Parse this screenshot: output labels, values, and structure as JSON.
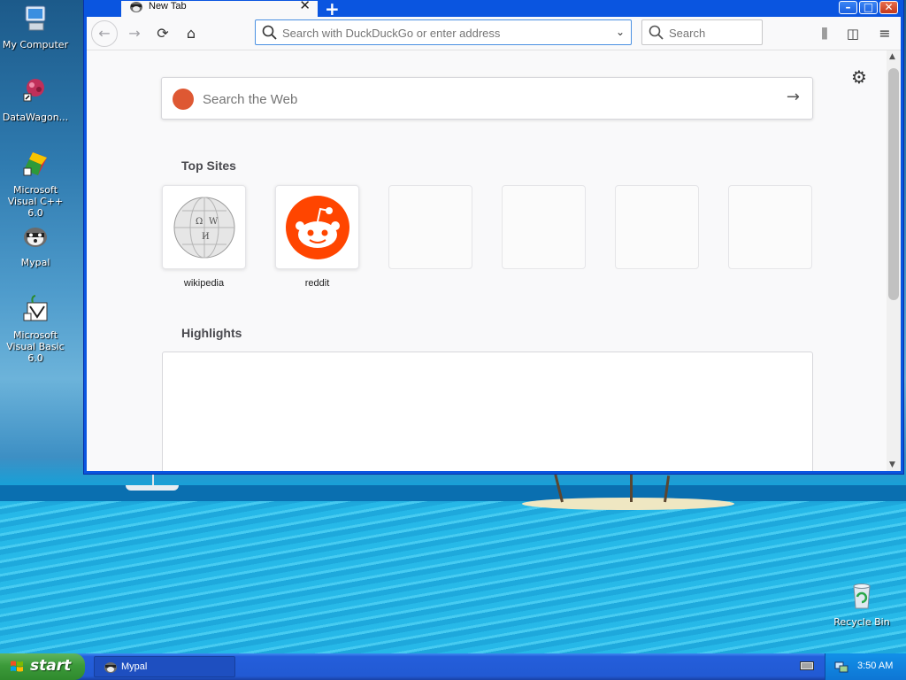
{
  "desktop": {
    "icons": [
      {
        "label": "My Computer",
        "icon": "computer-icon"
      },
      {
        "label": "DataWagon...",
        "icon": "datawagon-icon"
      },
      {
        "label": "Microsoft Visual C++ 6.0",
        "icon": "visual-cpp-icon"
      },
      {
        "label": "Mypal",
        "icon": "mypal-icon"
      },
      {
        "label": "Microsoft Visual Basic 6.0",
        "icon": "visual-basic-icon"
      },
      {
        "label": "Recycle Bin",
        "icon": "recycle-bin-icon"
      }
    ]
  },
  "browser": {
    "tab": {
      "title": "New Tab",
      "close": "✕"
    },
    "new_tab": "+",
    "window_buttons": {
      "minimize": "–",
      "maximize": "□",
      "close": "✕"
    },
    "urlbar": {
      "placeholder": "Search with DuckDuckGo or enter address"
    },
    "searchbar": {
      "placeholder": "Search"
    },
    "newtab_page": {
      "websearch_placeholder": "Search the Web",
      "top_sites_title": "Top Sites",
      "top_sites": [
        {
          "label": "wikipedia",
          "icon": "wikipedia-icon"
        },
        {
          "label": "reddit",
          "icon": "reddit-icon"
        },
        {
          "label": ""
        },
        {
          "label": ""
        },
        {
          "label": ""
        },
        {
          "label": ""
        }
      ],
      "highlights_title": "Highlights"
    }
  },
  "taskbar": {
    "start": "start",
    "items": [
      {
        "label": "Mypal",
        "icon": "mypal-icon"
      }
    ],
    "clock": "3:50 AM"
  },
  "colors": {
    "accent": "#0a55e0",
    "reddit": "#ff4500",
    "duckduckgo": "#de5833",
    "start": "#3c9a3a"
  }
}
